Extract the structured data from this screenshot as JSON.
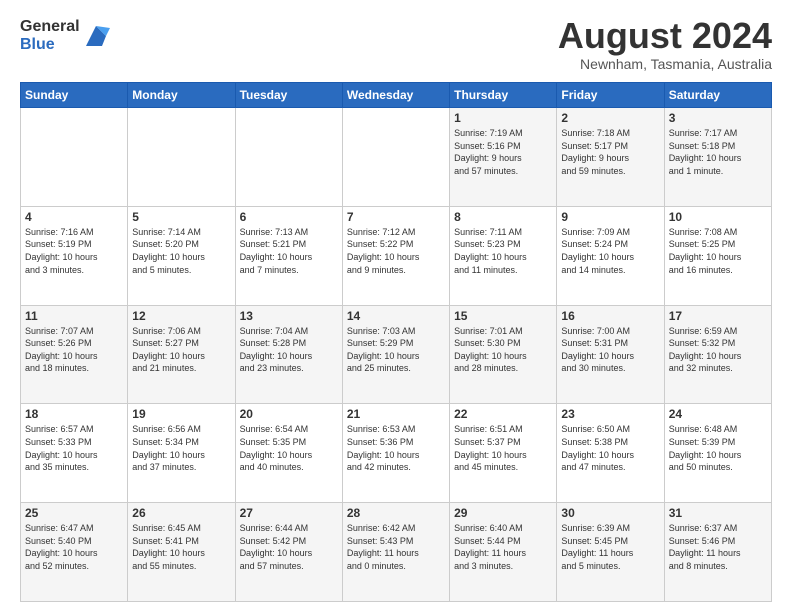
{
  "logo": {
    "general": "General",
    "blue": "Blue"
  },
  "title": {
    "month_year": "August 2024",
    "location": "Newnham, Tasmania, Australia"
  },
  "days_of_week": [
    "Sunday",
    "Monday",
    "Tuesday",
    "Wednesday",
    "Thursday",
    "Friday",
    "Saturday"
  ],
  "weeks": [
    [
      {
        "day": "",
        "info": ""
      },
      {
        "day": "",
        "info": ""
      },
      {
        "day": "",
        "info": ""
      },
      {
        "day": "",
        "info": ""
      },
      {
        "day": "1",
        "info": "Sunrise: 7:19 AM\nSunset: 5:16 PM\nDaylight: 9 hours\nand 57 minutes."
      },
      {
        "day": "2",
        "info": "Sunrise: 7:18 AM\nSunset: 5:17 PM\nDaylight: 9 hours\nand 59 minutes."
      },
      {
        "day": "3",
        "info": "Sunrise: 7:17 AM\nSunset: 5:18 PM\nDaylight: 10 hours\nand 1 minute."
      }
    ],
    [
      {
        "day": "4",
        "info": "Sunrise: 7:16 AM\nSunset: 5:19 PM\nDaylight: 10 hours\nand 3 minutes."
      },
      {
        "day": "5",
        "info": "Sunrise: 7:14 AM\nSunset: 5:20 PM\nDaylight: 10 hours\nand 5 minutes."
      },
      {
        "day": "6",
        "info": "Sunrise: 7:13 AM\nSunset: 5:21 PM\nDaylight: 10 hours\nand 7 minutes."
      },
      {
        "day": "7",
        "info": "Sunrise: 7:12 AM\nSunset: 5:22 PM\nDaylight: 10 hours\nand 9 minutes."
      },
      {
        "day": "8",
        "info": "Sunrise: 7:11 AM\nSunset: 5:23 PM\nDaylight: 10 hours\nand 11 minutes."
      },
      {
        "day": "9",
        "info": "Sunrise: 7:09 AM\nSunset: 5:24 PM\nDaylight: 10 hours\nand 14 minutes."
      },
      {
        "day": "10",
        "info": "Sunrise: 7:08 AM\nSunset: 5:25 PM\nDaylight: 10 hours\nand 16 minutes."
      }
    ],
    [
      {
        "day": "11",
        "info": "Sunrise: 7:07 AM\nSunset: 5:26 PM\nDaylight: 10 hours\nand 18 minutes."
      },
      {
        "day": "12",
        "info": "Sunrise: 7:06 AM\nSunset: 5:27 PM\nDaylight: 10 hours\nand 21 minutes."
      },
      {
        "day": "13",
        "info": "Sunrise: 7:04 AM\nSunset: 5:28 PM\nDaylight: 10 hours\nand 23 minutes."
      },
      {
        "day": "14",
        "info": "Sunrise: 7:03 AM\nSunset: 5:29 PM\nDaylight: 10 hours\nand 25 minutes."
      },
      {
        "day": "15",
        "info": "Sunrise: 7:01 AM\nSunset: 5:30 PM\nDaylight: 10 hours\nand 28 minutes."
      },
      {
        "day": "16",
        "info": "Sunrise: 7:00 AM\nSunset: 5:31 PM\nDaylight: 10 hours\nand 30 minutes."
      },
      {
        "day": "17",
        "info": "Sunrise: 6:59 AM\nSunset: 5:32 PM\nDaylight: 10 hours\nand 32 minutes."
      }
    ],
    [
      {
        "day": "18",
        "info": "Sunrise: 6:57 AM\nSunset: 5:33 PM\nDaylight: 10 hours\nand 35 minutes."
      },
      {
        "day": "19",
        "info": "Sunrise: 6:56 AM\nSunset: 5:34 PM\nDaylight: 10 hours\nand 37 minutes."
      },
      {
        "day": "20",
        "info": "Sunrise: 6:54 AM\nSunset: 5:35 PM\nDaylight: 10 hours\nand 40 minutes."
      },
      {
        "day": "21",
        "info": "Sunrise: 6:53 AM\nSunset: 5:36 PM\nDaylight: 10 hours\nand 42 minutes."
      },
      {
        "day": "22",
        "info": "Sunrise: 6:51 AM\nSunset: 5:37 PM\nDaylight: 10 hours\nand 45 minutes."
      },
      {
        "day": "23",
        "info": "Sunrise: 6:50 AM\nSunset: 5:38 PM\nDaylight: 10 hours\nand 47 minutes."
      },
      {
        "day": "24",
        "info": "Sunrise: 6:48 AM\nSunset: 5:39 PM\nDaylight: 10 hours\nand 50 minutes."
      }
    ],
    [
      {
        "day": "25",
        "info": "Sunrise: 6:47 AM\nSunset: 5:40 PM\nDaylight: 10 hours\nand 52 minutes."
      },
      {
        "day": "26",
        "info": "Sunrise: 6:45 AM\nSunset: 5:41 PM\nDaylight: 10 hours\nand 55 minutes."
      },
      {
        "day": "27",
        "info": "Sunrise: 6:44 AM\nSunset: 5:42 PM\nDaylight: 10 hours\nand 57 minutes."
      },
      {
        "day": "28",
        "info": "Sunrise: 6:42 AM\nSunset: 5:43 PM\nDaylight: 11 hours\nand 0 minutes."
      },
      {
        "day": "29",
        "info": "Sunrise: 6:40 AM\nSunset: 5:44 PM\nDaylight: 11 hours\nand 3 minutes."
      },
      {
        "day": "30",
        "info": "Sunrise: 6:39 AM\nSunset: 5:45 PM\nDaylight: 11 hours\nand 5 minutes."
      },
      {
        "day": "31",
        "info": "Sunrise: 6:37 AM\nSunset: 5:46 PM\nDaylight: 11 hours\nand 8 minutes."
      }
    ]
  ]
}
